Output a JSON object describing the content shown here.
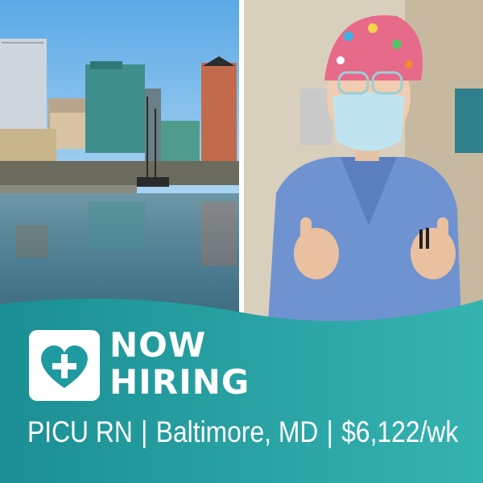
{
  "headline": {
    "line1": "NOW",
    "line2": "HIRING"
  },
  "job": {
    "role": "PICU RN",
    "location": "Baltimore, MD",
    "pay": "$6,122/wk",
    "separator": "|"
  },
  "icons": {
    "logo": "heart-plus-icon"
  },
  "colors": {
    "banner_teal": "#2aa3a7",
    "banner_teal_dark": "#1b8f94",
    "text": "#ffffff",
    "scrubs_blue": "#6f93d1"
  }
}
